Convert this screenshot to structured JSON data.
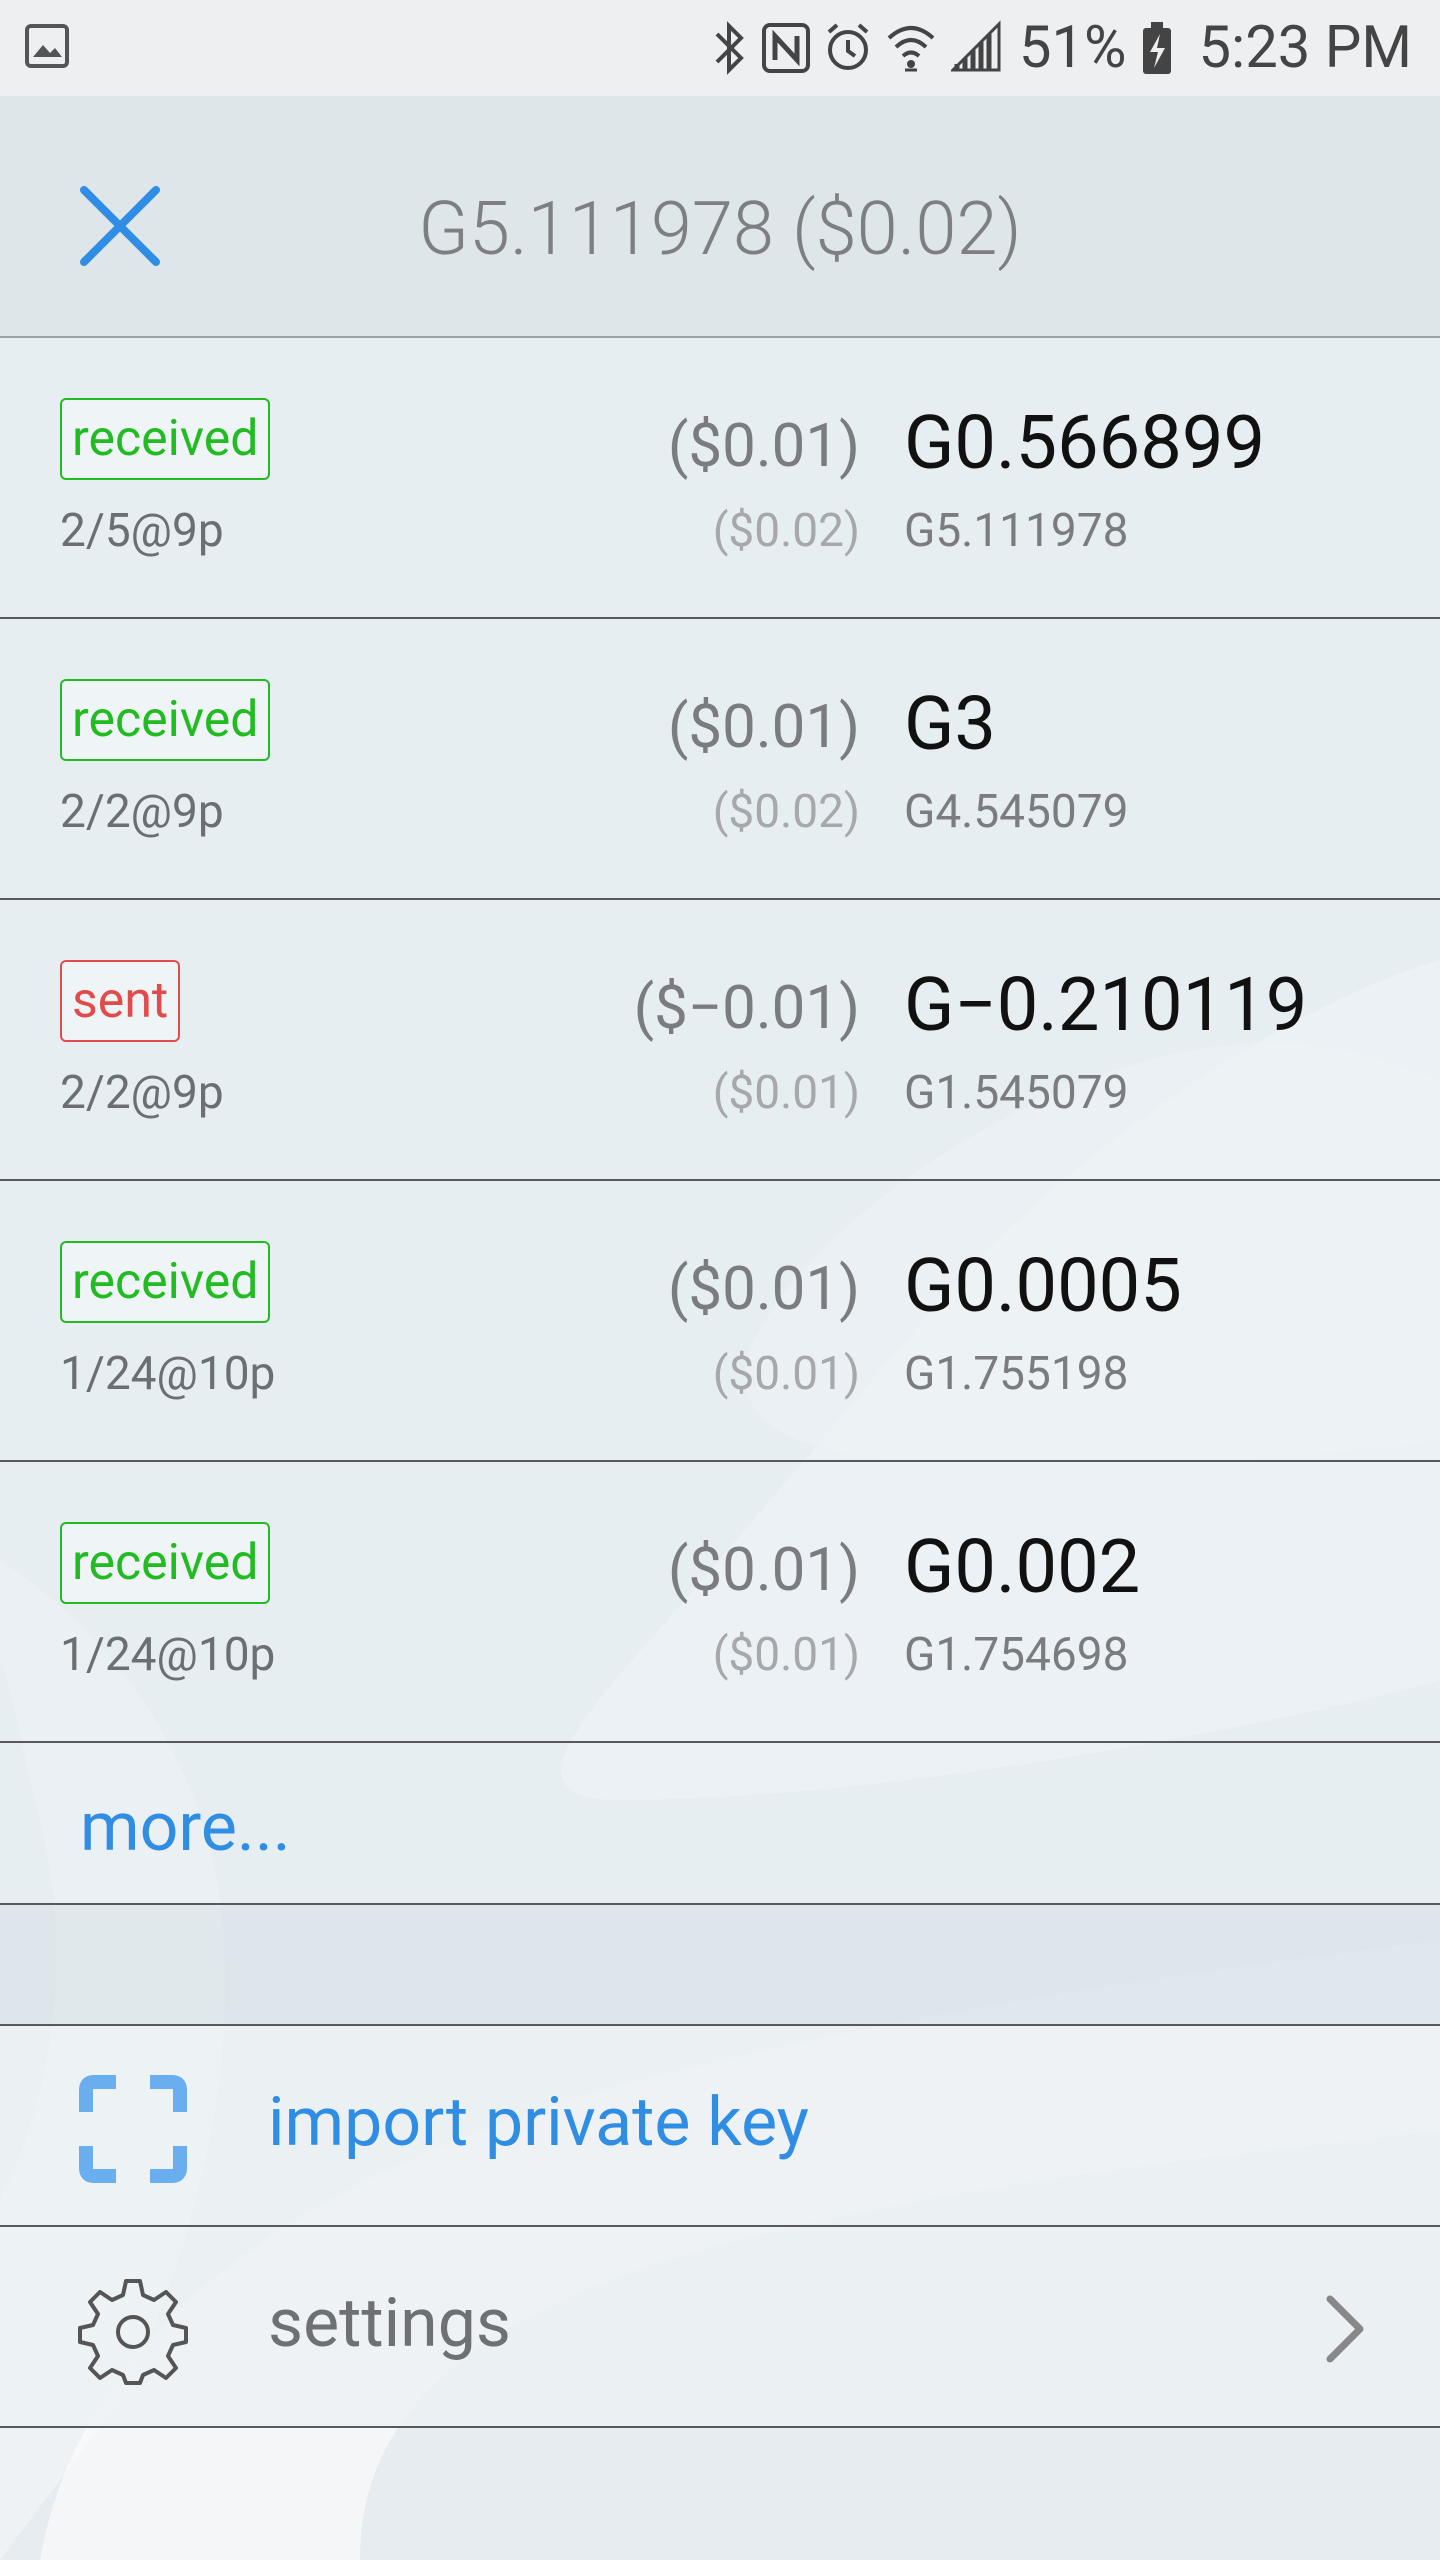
{
  "status_bar": {
    "battery_percent": "51%",
    "time": "5:23 PM",
    "icons": [
      "image-icon",
      "bluetooth-icon",
      "nfc-icon",
      "alarm-icon",
      "wifi-icon",
      "signal-icon",
      "battery-charging-icon"
    ]
  },
  "header": {
    "title": "G5.111978 ($0.02)",
    "close_icon": "close-icon",
    "accent_color": "#2f8de4"
  },
  "transactions": [
    {
      "status": "received",
      "date": "2/5@9p",
      "fiat_change": "($0.01)",
      "amount": "G0.566899",
      "fiat_balance": "($0.02)",
      "balance": "G5.111978"
    },
    {
      "status": "received",
      "date": "2/2@9p",
      "fiat_change": "($0.01)",
      "amount": "G3",
      "fiat_balance": "($0.02)",
      "balance": "G4.545079"
    },
    {
      "status": "sent",
      "date": "2/2@9p",
      "fiat_change": "($−0.01)",
      "amount": "G−0.210119",
      "fiat_balance": "($0.01)",
      "balance": "G1.545079"
    },
    {
      "status": "received",
      "date": "1/24@10p",
      "fiat_change": "($0.01)",
      "amount": "G0.0005",
      "fiat_balance": "($0.01)",
      "balance": "G1.755198"
    },
    {
      "status": "received",
      "date": "1/24@10p",
      "fiat_change": "($0.01)",
      "amount": "G0.002",
      "fiat_balance": "($0.01)",
      "balance": "G1.754698"
    }
  ],
  "more_label": "more...",
  "menu": {
    "import_label": "import private key",
    "import_icon": "scan-frame-icon",
    "settings_label": "settings",
    "settings_icon": "gear-icon",
    "chevron_icon": "chevron-right-icon"
  },
  "colors": {
    "received": "#22bb22",
    "sent": "#e24b4b",
    "link": "#2f8de4"
  }
}
